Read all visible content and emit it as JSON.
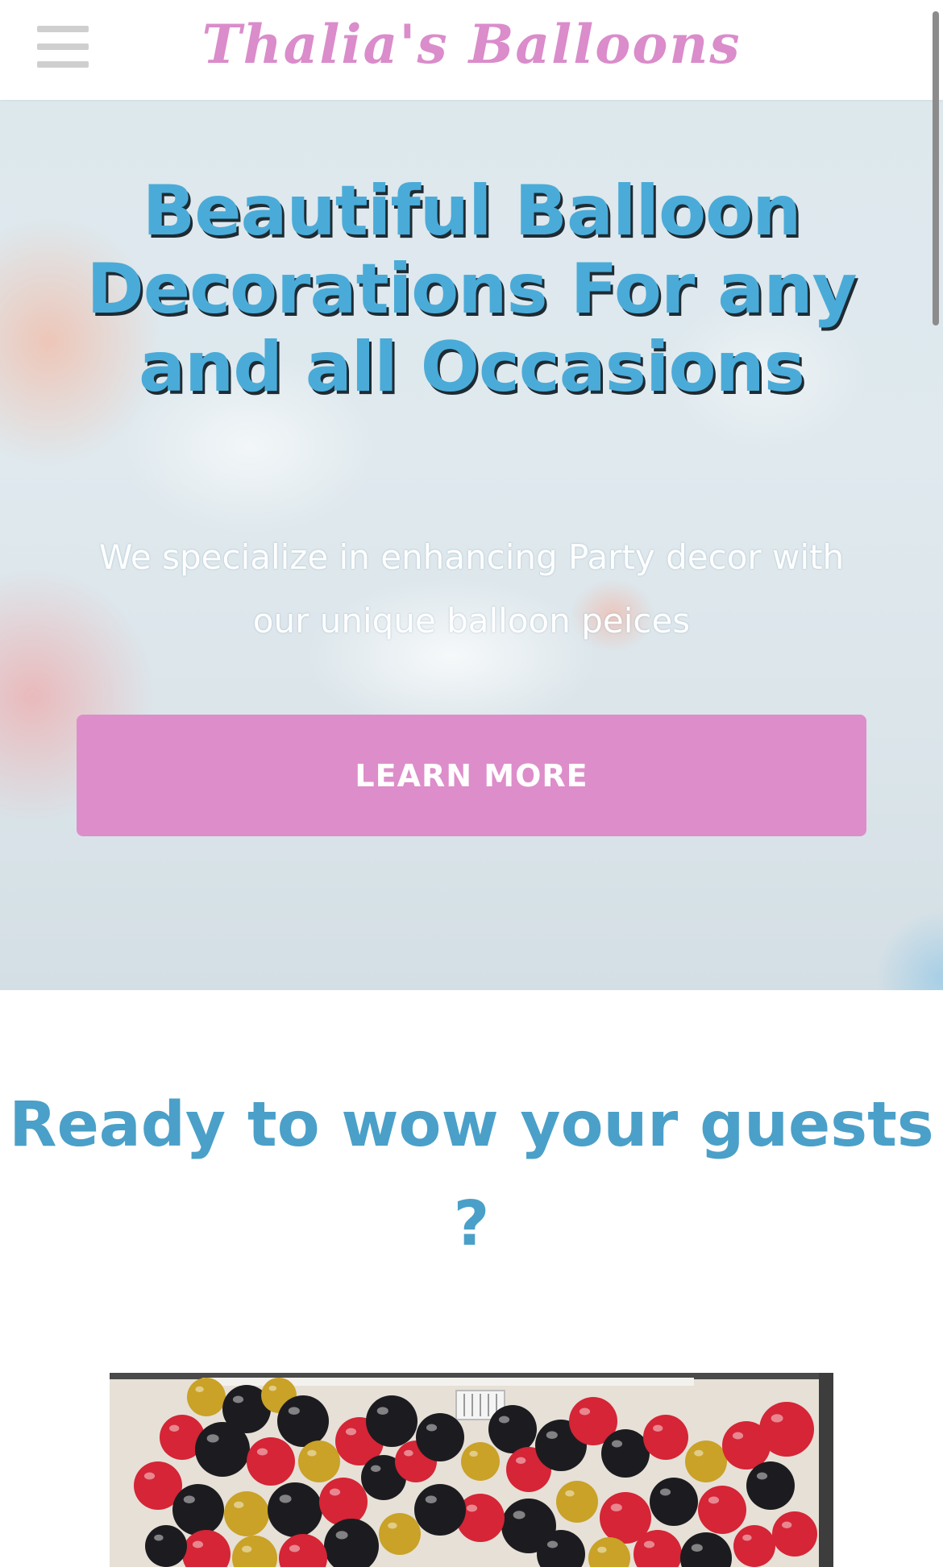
{
  "header": {
    "brand": "Thalia's Balloons",
    "menu_icon": "hamburger-menu-icon"
  },
  "hero": {
    "title": "Beautiful Balloon Decorations For any and all Occasions",
    "subtitle": "We specialize in enhancing Party decor with our unique balloon peices",
    "cta_label": "LEARN MORE"
  },
  "section": {
    "title": "Ready to wow your guests ?"
  },
  "colors": {
    "brand_pink": "#da8ccb",
    "cta_pink": "#dd8dca",
    "title_blue": "#4aabd8",
    "section_blue": "#4aa0c8"
  }
}
